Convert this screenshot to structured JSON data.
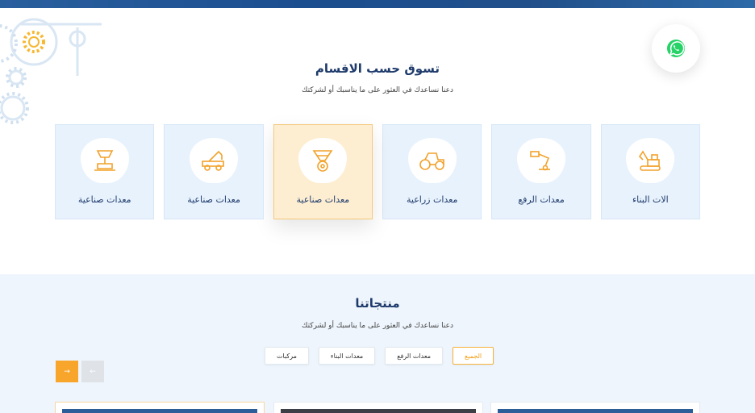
{
  "contact": {
    "icon": "whatsapp-icon",
    "color": "#25d366"
  },
  "categories_section": {
    "title": "تسوق حسب الاقسام",
    "subtitle": "دعنا نساعدك في العثور على ما يناسبك أو لشركتك",
    "items": [
      {
        "label": "الات البناء",
        "icon": "excavator-icon"
      },
      {
        "label": "معدات الرفع",
        "icon": "crane-arm-icon"
      },
      {
        "label": "معدات زراعية",
        "icon": "tractor-icon"
      },
      {
        "label": "معدات صناعية",
        "icon": "drill-gear-icon",
        "active": true
      },
      {
        "label": "معدات صناعية",
        "icon": "crane-truck-icon"
      },
      {
        "label": "معدات صناعية",
        "icon": "hydraulic-press-icon"
      }
    ]
  },
  "products_section": {
    "title": "منتجاتنا",
    "subtitle": "دعنا نساعدك في العثور على ما يناسبك أو لشركتك",
    "filters": [
      {
        "label": "الجميع",
        "active": true
      },
      {
        "label": "معدات الرفع"
      },
      {
        "label": "معدات البناء"
      },
      {
        "label": "مركبات"
      }
    ],
    "next_arrow": "→",
    "prev_arrow": "←"
  },
  "colors": {
    "accent": "#f7a52b",
    "primary": "#1d3a6b",
    "card_bg": "#e8f2fd"
  }
}
